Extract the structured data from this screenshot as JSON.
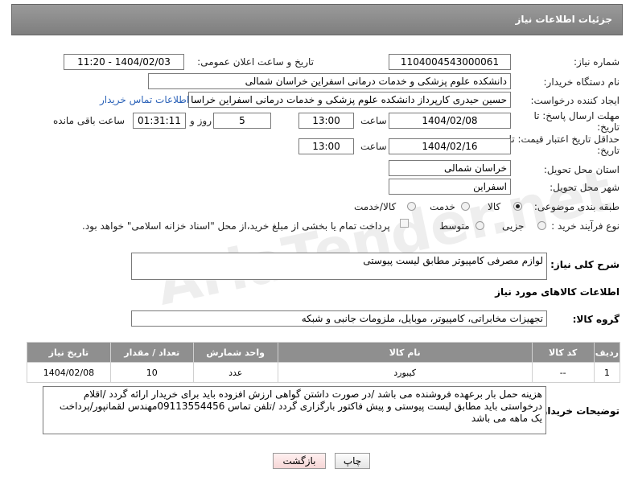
{
  "header": {
    "title": "جزئیات اطلاعات نیاز"
  },
  "form": {
    "need_number_label": "شماره نیاز:",
    "need_number": "1104004543000061",
    "announce_label": "تاریخ و ساعت اعلان عمومی:",
    "announce_value": "1404/02/03 - 11:20",
    "buyer_org_label": "نام دستگاه خریدار:",
    "buyer_org": "دانشکده علوم پزشکی و خدمات درمانی اسفراین خراسان شمالی",
    "creator_label": "ایجاد کننده درخواست:",
    "creator": "حسین  حیدری کارپرداز دانشکده علوم پزشکی و خدمات درمانی اسفراین خراسا",
    "contact_link": "اطلاعات تماس خریدار",
    "deadline_label": "مهلت ارسال پاسخ: تا تاریخ:",
    "deadline_date": "1404/02/08",
    "time_label": "ساعت",
    "deadline_time": "13:00",
    "days_value": "5",
    "days_label": "روز و",
    "remaining_time": "01:31:11",
    "remaining_label": "ساعت باقی مانده",
    "validity_label": "حداقل تاریخ اعتبار قیمت: تا تاریخ:",
    "validity_date": "1404/02/16",
    "validity_time": "13:00",
    "province_label": "استان محل تحویل:",
    "province": "خراسان شمالی",
    "city_label": "شهر محل تحویل:",
    "city": "اسفراین",
    "category_label": "طبقه بندی موضوعی:",
    "category_options": [
      "کالا",
      "خدمت",
      "کالا/خدمت"
    ],
    "category_selected": "کالا",
    "process_label": "نوع فرآیند خرید :",
    "process_options": [
      "جزیی",
      "متوسط"
    ],
    "process_selected": "",
    "payment_note": "پرداخت تمام یا بخشی از مبلغ خرید،از محل \"اسناد خزانه اسلامی\" خواهد بود."
  },
  "description": {
    "label": "شرح کلی نیاز:",
    "value": "لوازم مصرفی کامپیوتر مطابق لیست پیوستی"
  },
  "goods": {
    "section_title": "اطلاعات کالاهای مورد نیاز",
    "group_label": "گروه کالا:",
    "group_value": "تجهیزات مخابراتی، کامپیوتر، موبایل، ملزومات جانبی و شبکه",
    "columns": [
      "ردیف",
      "کد کالا",
      "نام کالا",
      "واحد شمارش",
      "تعداد / مقدار",
      "تاریخ نیاز"
    ],
    "rows": [
      [
        "1",
        "--",
        "کیبورد",
        "عدد",
        "10",
        "1404/02/08"
      ]
    ]
  },
  "buyer_notes": {
    "label": "توضیحات خریدار:",
    "value": "هزینه حمل بار برعهده فروشنده می باشد /در صورت داشتن گواهی ارزش افزوده باید برای خریدار ارائه گردد /اقلام درخواستی باید مطابق لیست پیوستی و پیش فاکتور بارگزاری گردد /تلفن تماس 09113554456مهندس لقمانپور/پرداخت یک ماهه می باشد"
  },
  "buttons": {
    "print": "چاپ",
    "back": "بازگشت"
  },
  "watermark": "AriaTender.net"
}
